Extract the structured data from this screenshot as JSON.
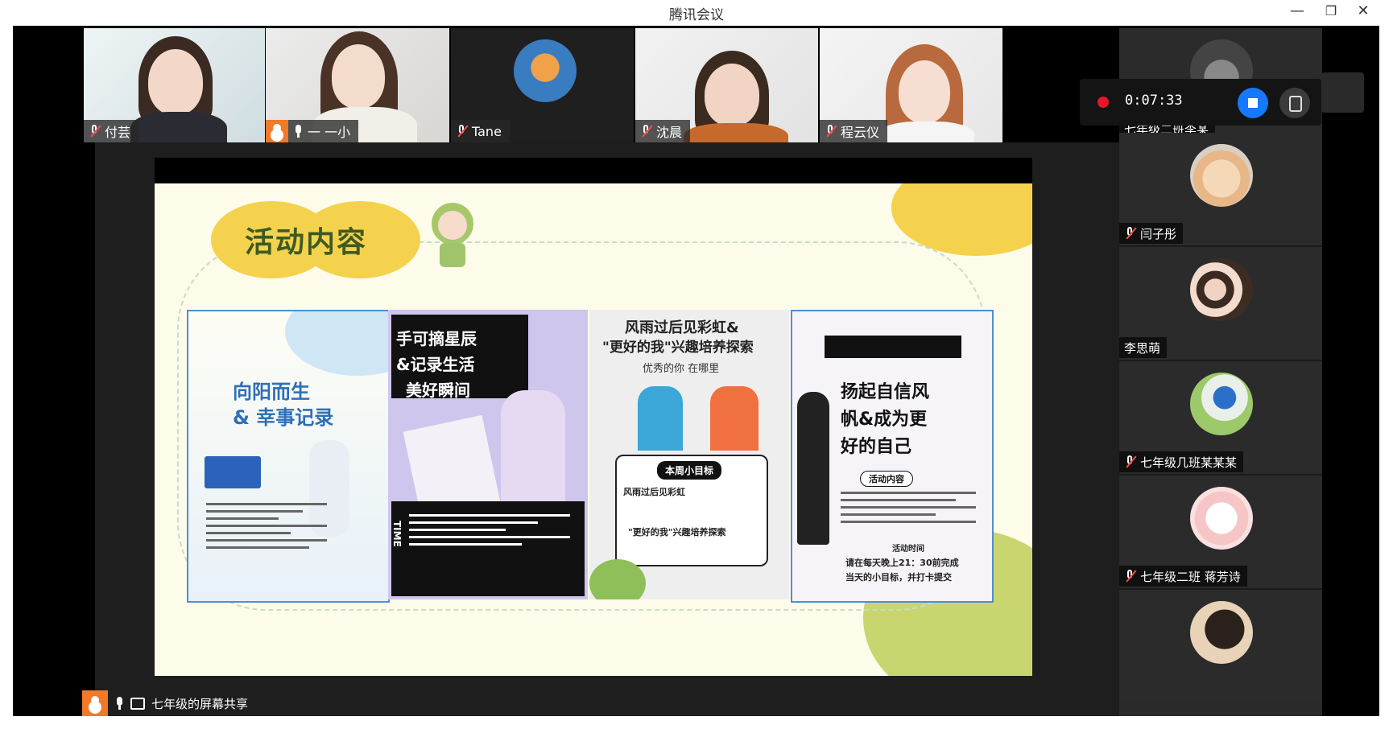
{
  "window": {
    "title": "腾讯会议",
    "minimize_icon": "—",
    "restore_icon": "❐",
    "close_icon": "✕"
  },
  "video_strip": [
    {
      "name": "付芸",
      "mic": "muted"
    },
    {
      "name": "一 一小",
      "mic": "on",
      "host": true,
      "speaking": true
    },
    {
      "name": "Tane",
      "mic": "muted"
    },
    {
      "name": "沈晨",
      "mic": "muted"
    },
    {
      "name": "程云仪",
      "mic": "muted"
    }
  ],
  "recording": {
    "time": "0:07:33",
    "stop_icon": "stop-square",
    "pause_icon": "pause"
  },
  "right_column": [
    {
      "name": "七年级二班李某",
      "mic": "none"
    },
    {
      "name": "闫子彤",
      "mic": "muted"
    },
    {
      "name": "李思萌",
      "mic": "none"
    },
    {
      "name": "七年级几班某某某",
      "mic": "muted"
    },
    {
      "name": "七年级二班 蒋芳诗",
      "mic": "muted"
    },
    {
      "name": "",
      "mic": "none"
    }
  ],
  "share_bar": {
    "label": "七年级的屏幕共享"
  },
  "slide": {
    "title": "活动内容",
    "panels": [
      {
        "title_line1": "向阳而生",
        "title_line2": "& 幸事记录"
      },
      {
        "title_line1": "手可摘星辰",
        "title_line2": "&记录生活",
        "title_line3": "美好瞬间",
        "time_label": "TIME"
      },
      {
        "title_line1": "风雨过后见彩虹&",
        "title_line2": "\"更好的我\"兴趣培养探索",
        "subtitle": "优秀的你 在哪里",
        "box_title": "本周小目标",
        "box_line1": "风雨过后见彩虹",
        "box_line2": "\"更好的我\"兴趣培养探索"
      },
      {
        "title_line1": "扬起自信风",
        "title_line2": "帆&成为更",
        "title_line3": "好的自己",
        "box_title": "活动内容",
        "tail_title": "活动时间",
        "tail_line1": "请在每天晚上21：30前完成",
        "tail_line2": "当天的小目标，并打卡提交"
      }
    ]
  },
  "colors": {
    "accent_green": "#1fc071",
    "record_red": "#e8152b",
    "stop_blue": "#1677ff",
    "host_orange": "#f07a2a",
    "slide_title": "#3d5a22",
    "slide_bg": "#fdfbea",
    "yellow_blob": "#f5d24e",
    "olive_blob": "#c9d66f"
  }
}
